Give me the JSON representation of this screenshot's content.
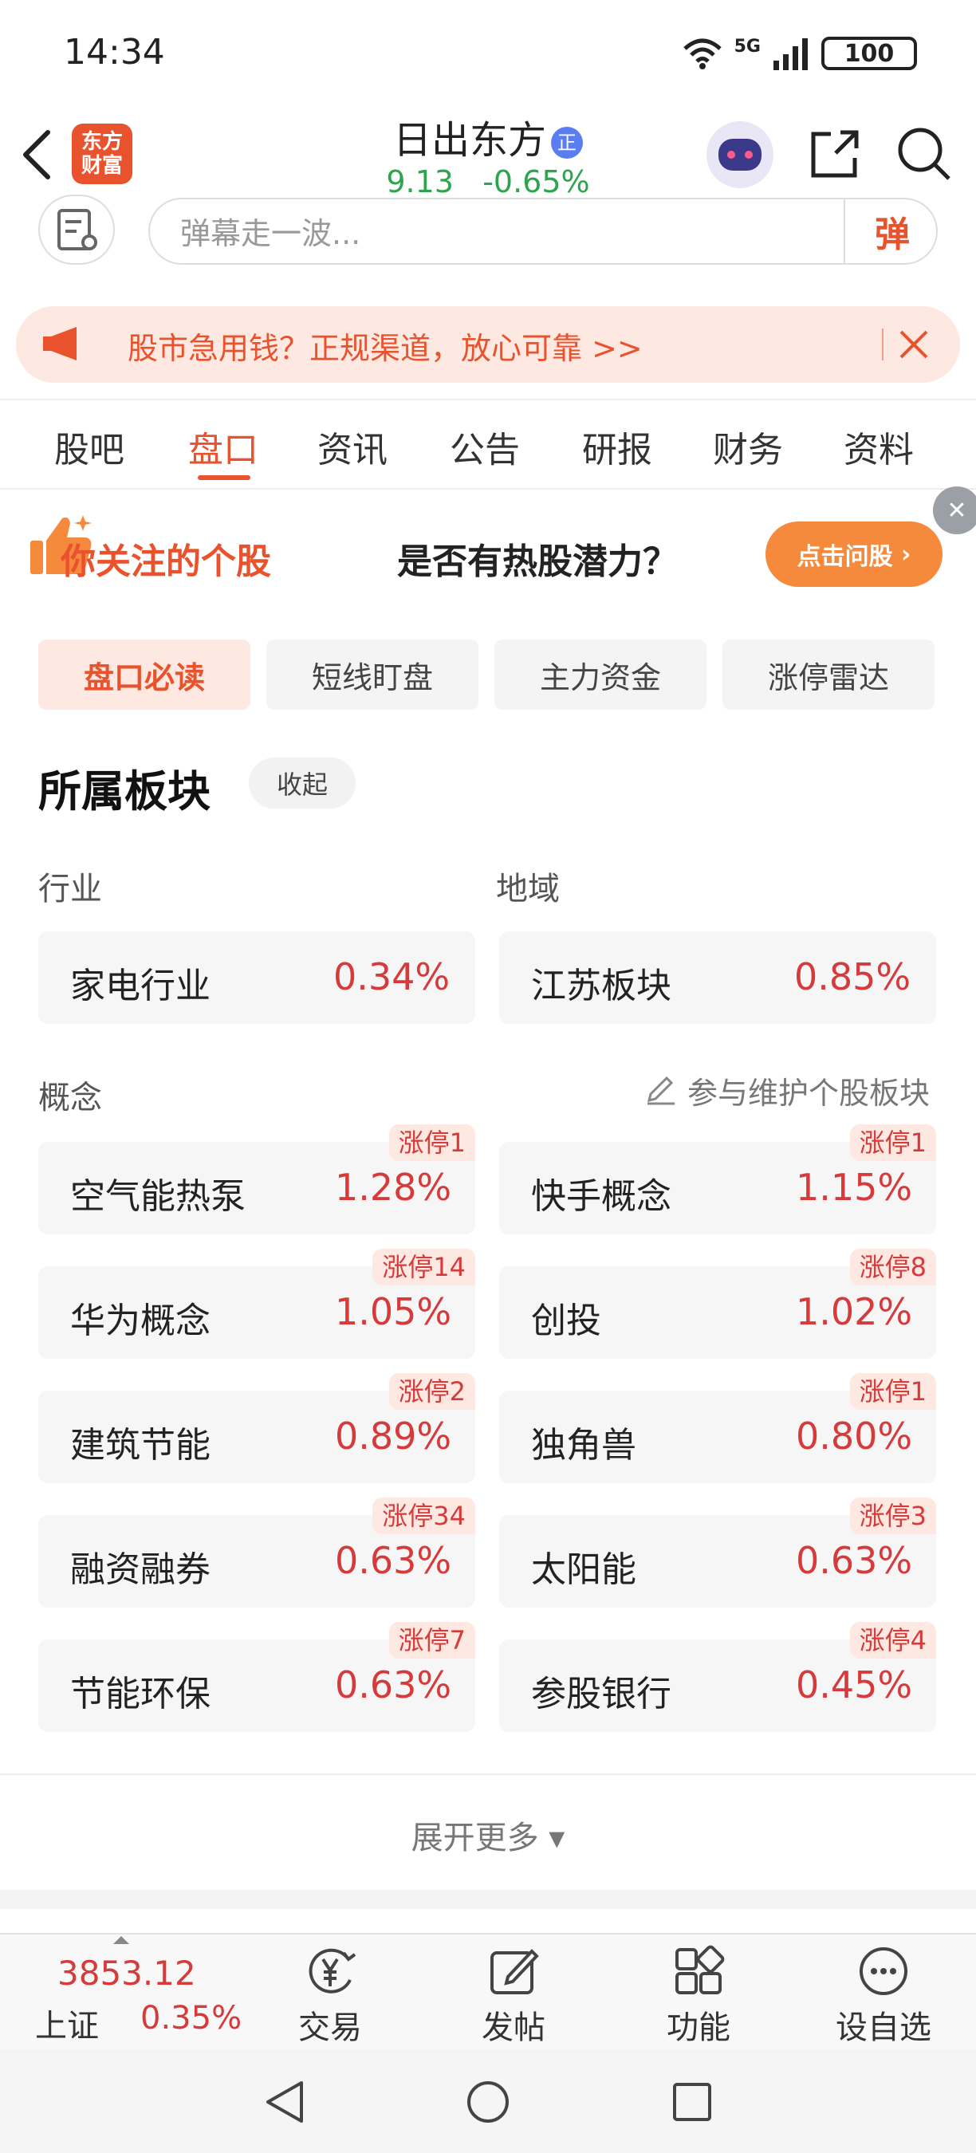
{
  "status": {
    "time": "14:34",
    "battery": "100",
    "network": "5G"
  },
  "header": {
    "brand": [
      "东方",
      "财富"
    ],
    "title": "日出东方",
    "title_badge": "正",
    "price": "9.13",
    "change": "-0.65%"
  },
  "danmaku": {
    "placeholder": "弹幕走一波...",
    "send_label": "弹"
  },
  "promo": {
    "text": "股市急用钱？正规渠道，放心可靠 >>"
  },
  "tabs": [
    {
      "label": "股吧",
      "active": false
    },
    {
      "label": "盘口",
      "active": true
    },
    {
      "label": "资讯",
      "active": false
    },
    {
      "label": "公告",
      "active": false
    },
    {
      "label": "研报",
      "active": false
    },
    {
      "label": "财务",
      "active": false
    },
    {
      "label": "资料",
      "active": false
    }
  ],
  "ai_banner": {
    "left_text": "你关注的个股",
    "right_text": "是否有热股潜力？",
    "button": "点击问股"
  },
  "subtabs": [
    {
      "label": "盘口必读",
      "active": true
    },
    {
      "label": "短线盯盘",
      "active": false
    },
    {
      "label": "主力资金",
      "active": false
    },
    {
      "label": "涨停雷达",
      "active": false
    }
  ],
  "section": {
    "title": "所属板块",
    "collapse": "收起",
    "industry_label": "行业",
    "region_label": "地域",
    "industry": {
      "name": "家电行业",
      "pct": "0.34%"
    },
    "region": {
      "name": "江苏板块",
      "pct": "0.85%"
    },
    "concept_label": "概念",
    "maintain": "参与维护个股板块",
    "concepts": [
      {
        "name": "空气能热泵",
        "pct": "1.28%",
        "badge": "涨停1"
      },
      {
        "name": "快手概念",
        "pct": "1.15%",
        "badge": "涨停1"
      },
      {
        "name": "华为概念",
        "pct": "1.05%",
        "badge": "涨停14"
      },
      {
        "name": "创投",
        "pct": "1.02%",
        "badge": "涨停8"
      },
      {
        "name": "建筑节能",
        "pct": "0.89%",
        "badge": "涨停2"
      },
      {
        "name": "独角兽",
        "pct": "0.80%",
        "badge": "涨停1"
      },
      {
        "name": "融资融券",
        "pct": "0.63%",
        "badge": "涨停34"
      },
      {
        "name": "太阳能",
        "pct": "0.63%",
        "badge": "涨停3"
      },
      {
        "name": "节能环保",
        "pct": "0.63%",
        "badge": "涨停7"
      },
      {
        "name": "参股银行",
        "pct": "0.45%",
        "badge": "涨停4"
      }
    ],
    "expand": "展开更多 ▾"
  },
  "bottom_bar": {
    "index_value": "3853.12",
    "index_name": "上证",
    "index_pct": "0.35%",
    "items": [
      {
        "label": "交易",
        "icon": "yen-exchange-icon"
      },
      {
        "label": "发帖",
        "icon": "edit-icon"
      },
      {
        "label": "功能",
        "icon": "grid-icon"
      },
      {
        "label": "设自选",
        "icon": "more-circle-icon"
      }
    ]
  },
  "colors": {
    "accent": "#e8522c",
    "up": "#d63a3a",
    "down": "#2ea44f"
  }
}
